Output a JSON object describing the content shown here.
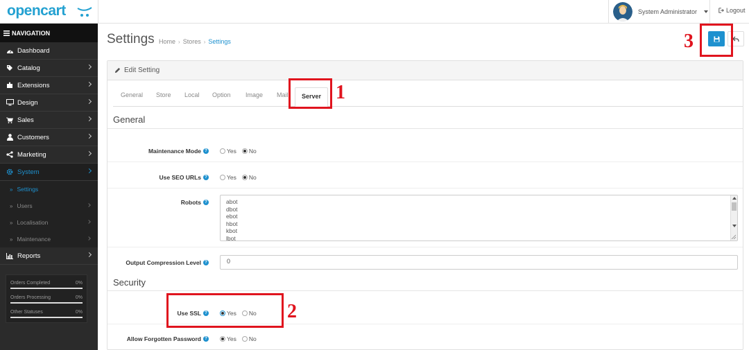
{
  "header": {
    "logo_text": "opencart",
    "user_name": "System Administrator",
    "logout_label": "Logout"
  },
  "sidebar": {
    "nav_title": "NAVIGATION",
    "items": [
      {
        "label": "Dashboard",
        "icon": "dashboard-icon"
      },
      {
        "label": "Catalog",
        "icon": "tag-icon"
      },
      {
        "label": "Extensions",
        "icon": "puzzle-icon"
      },
      {
        "label": "Design",
        "icon": "desktop-icon"
      },
      {
        "label": "Sales",
        "icon": "cart-icon"
      },
      {
        "label": "Customers",
        "icon": "user-icon"
      },
      {
        "label": "Marketing",
        "icon": "share-icon"
      },
      {
        "label": "System",
        "icon": "gear-icon"
      }
    ],
    "submenu": [
      {
        "label": "Settings"
      },
      {
        "label": "Users"
      },
      {
        "label": "Localisation"
      },
      {
        "label": "Maintenance"
      }
    ],
    "reports_label": "Reports",
    "stats": [
      {
        "label": "Orders Completed",
        "pct": "0%"
      },
      {
        "label": "Orders Processing",
        "pct": "0%"
      },
      {
        "label": "Other Statuses",
        "pct": "0%"
      }
    ]
  },
  "page": {
    "title": "Settings",
    "breadcrumb": [
      "Home",
      "Stores",
      "Settings"
    ],
    "panel_title": "Edit Setting",
    "tabs": [
      "General",
      "Store",
      "Local",
      "Option",
      "Image",
      "Mail",
      "Server"
    ],
    "active_tab": "Server"
  },
  "form": {
    "section_general": "General",
    "section_security": "Security",
    "maintenance_label": "Maintenance Mode",
    "seo_label": "Use SEO URLs",
    "robots_label": "Robots",
    "robots_lines": [
      "abot",
      "dbot",
      "ebot",
      "hbot",
      "kbot",
      "lbot"
    ],
    "compression_label": "Output Compression Level",
    "compression_value": "0",
    "ssl_label": "Use SSL",
    "forgotten_label": "Allow Forgotten Password",
    "yes": "Yes",
    "no": "No"
  },
  "annotations": {
    "n1": "1",
    "n2": "2",
    "n3": "3"
  },
  "colors": {
    "accent": "#1e91cf",
    "annotation": "#e0141e",
    "sidebar_bg": "#2b2b2b"
  }
}
